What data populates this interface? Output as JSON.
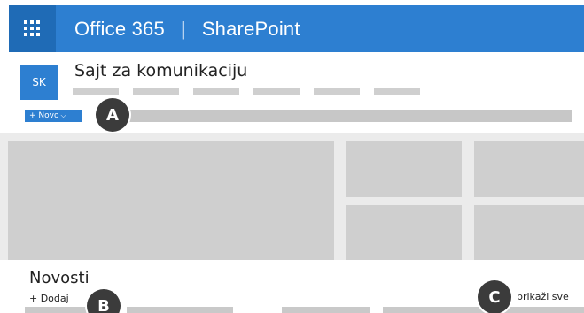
{
  "suite_bar": {
    "app_name": "Office 365",
    "separator": "|",
    "product": "SharePoint",
    "waffle_icon": "app-launcher-icon",
    "color": "#2d7fd1"
  },
  "site": {
    "logo_initials": "SK",
    "title": "Sajt za komunikaciju",
    "nav_item_count": 6
  },
  "command_bar": {
    "new_label": "+ Novo",
    "new_chevron": "⌵",
    "new_button_color": "#2d7fd1"
  },
  "callouts": {
    "a": "A",
    "b": "B",
    "c": "C"
  },
  "news": {
    "title": "Novosti",
    "add_label": "+ Dodaj",
    "see_all_label": "prikaži sve"
  }
}
